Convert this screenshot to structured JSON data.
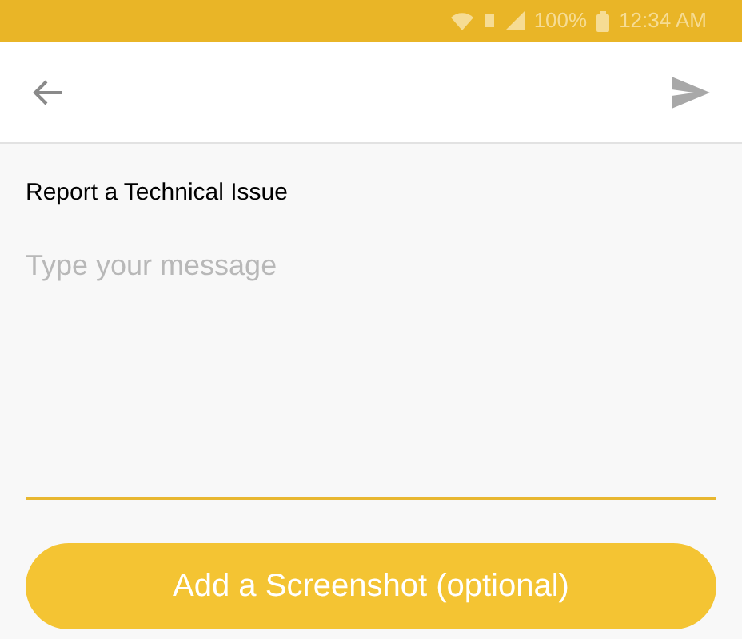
{
  "status_bar": {
    "battery": "100%",
    "time": "12:34 AM"
  },
  "form": {
    "title": "Report a Technical Issue",
    "message": {
      "placeholder": "Type your message"
    },
    "button": "Add a Screenshot (optional)"
  }
}
